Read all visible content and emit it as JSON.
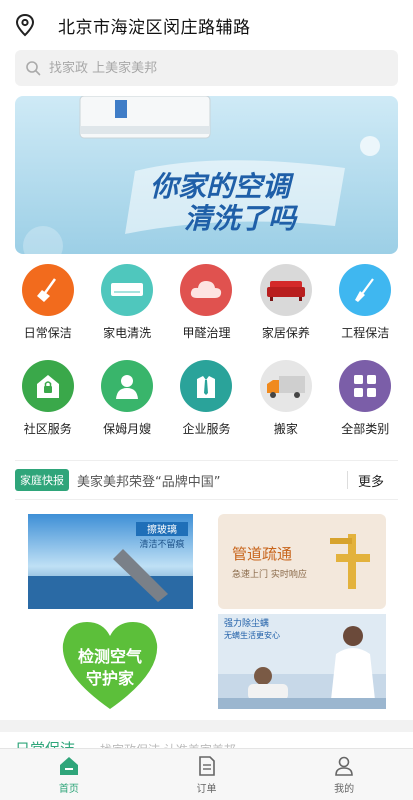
{
  "header": {
    "address": "北京市海淀区闵庄路辅路",
    "location_icon": "location-pin-icon"
  },
  "search": {
    "placeholder": "找家政 上美家美邦",
    "icon": "search-icon"
  },
  "banner": {
    "line1": "你家的空调",
    "line2": "清洗了吗"
  },
  "categories": [
    {
      "label": "日常保洁",
      "icon": "broom-icon",
      "color": "#f26b1d"
    },
    {
      "label": "家电清洗",
      "icon": "air-conditioner-icon",
      "color": "#4fc7bd"
    },
    {
      "label": "甲醛治理",
      "icon": "cloud-icon",
      "color": "#e0524f"
    },
    {
      "label": "家居保养",
      "icon": "sofa-icon",
      "color": "#d9d9d9"
    },
    {
      "label": "工程保洁",
      "icon": "mop-icon",
      "color": "#3fb7f0"
    },
    {
      "label": "社区服务",
      "icon": "house-lock-icon",
      "color": "#3aa84a"
    },
    {
      "label": "保姆月嫂",
      "icon": "nanny-icon",
      "color": "#39b56b"
    },
    {
      "label": "企业服务",
      "icon": "suit-icon",
      "color": "#2aa39a"
    },
    {
      "label": "搬家",
      "icon": "truck-icon",
      "color": "#e6e6e6"
    },
    {
      "label": "全部类别",
      "icon": "grid-icon",
      "color": "#7b5ea8"
    }
  ],
  "news": {
    "badge": "家庭快报",
    "text": "美家美邦荣登“品牌中国”",
    "more": "更多"
  },
  "promos": {
    "glass": {
      "line1": "擦玻璃",
      "line2": "清洁不留痕"
    },
    "pipe": {
      "title": "管道疏通",
      "subtitle": "急速上门 实时响应"
    },
    "air": {
      "line1": "检测空气",
      "line2": "守护家"
    },
    "mite": {
      "line1": "强力除尘螨",
      "line2": "无螨生活更安心"
    }
  },
  "section_peek": {
    "title": "日常保洁",
    "subtitle": "找家政保洁 认准美家美邦"
  },
  "tabbar": [
    {
      "label": "首页",
      "icon": "home-icon",
      "active": true
    },
    {
      "label": "订单",
      "icon": "order-icon",
      "active": false
    },
    {
      "label": "我的",
      "icon": "profile-icon",
      "active": false
    }
  ],
  "colors": {
    "accent": "#2fa57a",
    "banner_sky": "#bfe3f2"
  }
}
